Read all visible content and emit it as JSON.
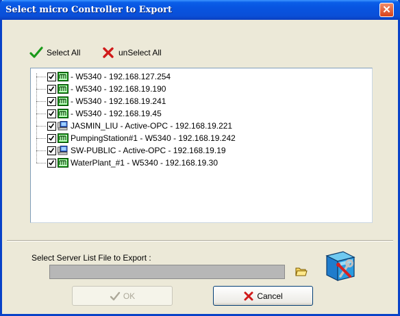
{
  "window": {
    "title": "Select micro Controller to Export",
    "accent_color": "#0a5ee8"
  },
  "toolbar": {
    "select_all_label": "Select All",
    "select_all_icon": "green-check-icon",
    "unselect_all_label": "unSelect All",
    "unselect_all_icon": "red-x-icon"
  },
  "controllers": [
    {
      "label": " - W5340 - 192.168.127.254",
      "icon": "controller-module-icon",
      "checked": true
    },
    {
      "label": " - W5340 - 192.168.19.190",
      "icon": "controller-module-icon",
      "checked": true
    },
    {
      "label": " - W5340 - 192.168.19.241",
      "icon": "controller-module-icon",
      "checked": true
    },
    {
      "label": " - W5340 - 192.168.19.45",
      "icon": "controller-module-icon",
      "checked": true
    },
    {
      "label": "JASMIN_LIU - Active-OPC - 192.168.19.221",
      "icon": "computer-icon",
      "checked": true
    },
    {
      "label": "PumpingStation#1 - W5340 - 192.168.19.242",
      "icon": "controller-module-icon",
      "checked": true
    },
    {
      "label": "SW-PUBLIC - Active-OPC - 192.168.19.19",
      "icon": "computer-icon",
      "checked": true
    },
    {
      "label": "WaterPlant_#1 - W5340 - 192.168.19.30",
      "icon": "controller-module-icon",
      "checked": true
    }
  ],
  "server_list": {
    "label": "Select Server List File to Export :",
    "path_value": "",
    "browse_icon": "open-folder-icon",
    "config_icon": "tools-config-icon"
  },
  "buttons": {
    "ok_label": "OK",
    "ok_enabled": false,
    "cancel_label": "Cancel"
  }
}
